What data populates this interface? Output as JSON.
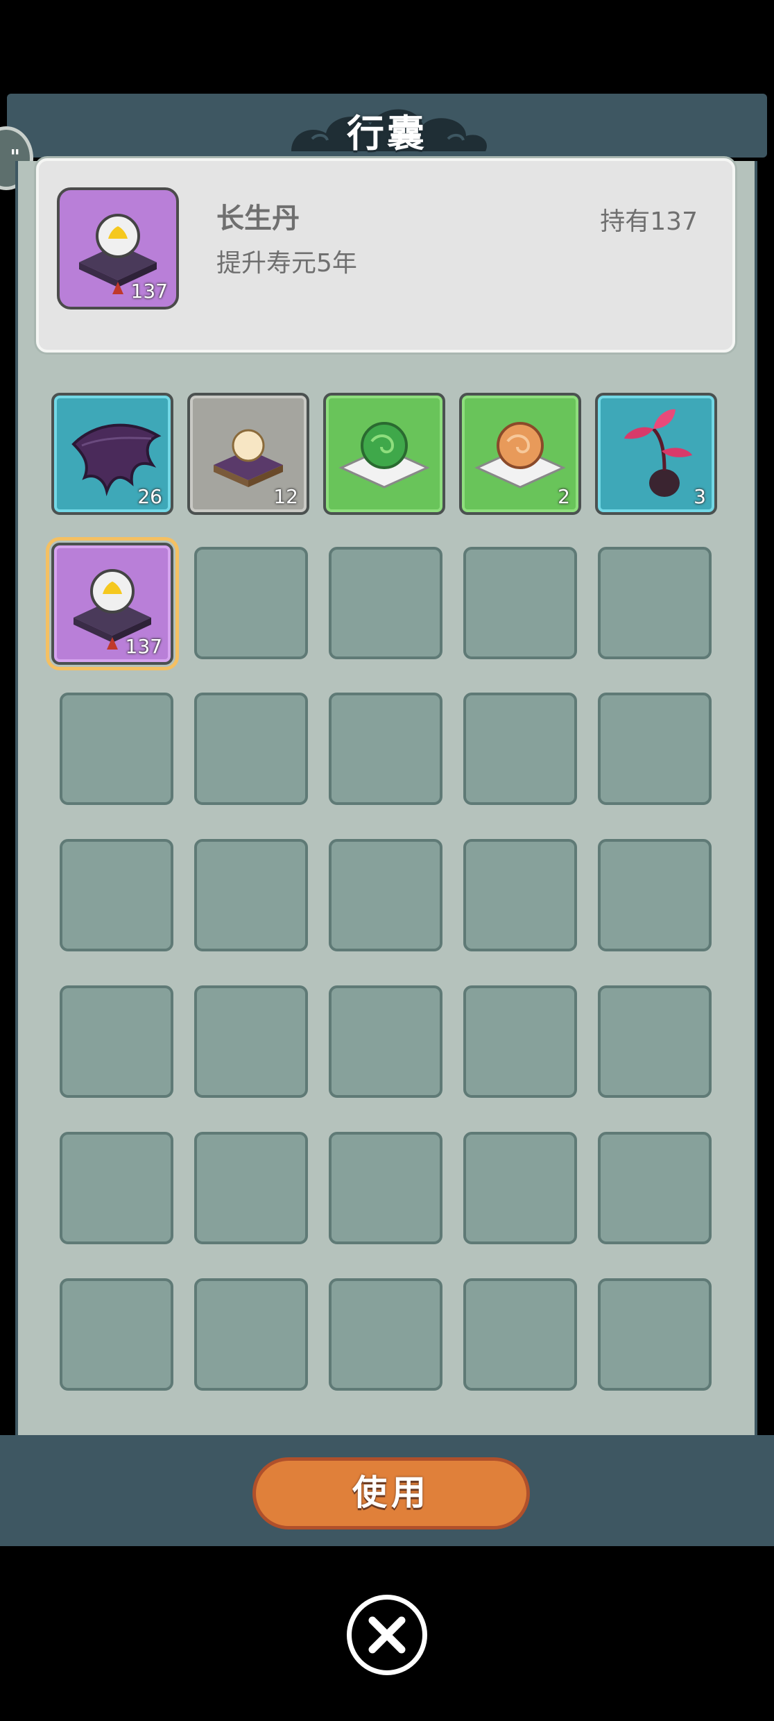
{
  "header": {
    "title": "行囊"
  },
  "side_tab": {
    "label": "\""
  },
  "detail": {
    "name": "长生丹",
    "description": "提升寿元5年",
    "held_label": "持有137",
    "icon": "pill-on-cushion-icon",
    "count": "137"
  },
  "inventory": {
    "items": [
      {
        "icon": "bat-wing-icon",
        "count": "26",
        "color": "cyan"
      },
      {
        "icon": "pearl-on-cushion-icon",
        "count": "12",
        "color": "gray"
      },
      {
        "icon": "green-orb-icon",
        "count": "",
        "color": "green"
      },
      {
        "icon": "orange-orb-icon",
        "count": "2",
        "color": "green"
      },
      {
        "icon": "red-sprout-icon",
        "count": "3",
        "color": "cyan"
      },
      {
        "icon": "pill-on-cushion-icon",
        "count": "137",
        "color": "purple",
        "selected": true
      }
    ],
    "empty_slots": 29
  },
  "footer": {
    "use_label": "使用"
  },
  "close": {
    "icon": "close-icon"
  },
  "colors": {
    "frame": "#3e5762",
    "panel": "#b5c2bc",
    "slot_empty": "#87a19b",
    "button": "#e0803a",
    "rarity_purple": "#b97fd8",
    "rarity_cyan": "#3ea8b8",
    "rarity_green": "#69c45a"
  }
}
